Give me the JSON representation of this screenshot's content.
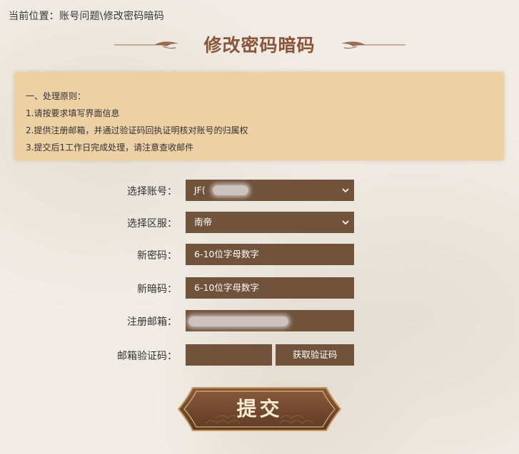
{
  "breadcrumb": {
    "text": "当前位置：账号问题\\修改密码暗码"
  },
  "page": {
    "title": "修改密码暗码"
  },
  "notice": {
    "lines": [
      "一、处理原则：",
      "1.请按要求填写界面信息",
      "2.提供注册邮箱，并通过验证码回执证明核对账号的归属权",
      "3.提交后1工作日完成处理，请注意查收邮件"
    ]
  },
  "form": {
    "account": {
      "label": "选择账号：",
      "value": "JF("
    },
    "server": {
      "label": "选择区服：",
      "value": "南帝"
    },
    "new_password": {
      "label": "新密码：",
      "placeholder": "6-10位字母数字"
    },
    "new_secret": {
      "label": "新暗码：",
      "placeholder": "6-10位字母数字"
    },
    "email": {
      "label": "注册邮箱："
    },
    "email_code": {
      "label": "邮箱验证码：",
      "button": "获取验证码"
    }
  },
  "submit": {
    "label": "提交"
  },
  "colors": {
    "field_bg": "#71523a",
    "title": "#8a5538",
    "notice_bg": "#edd0a4",
    "page_bg": "#f1ede6"
  }
}
